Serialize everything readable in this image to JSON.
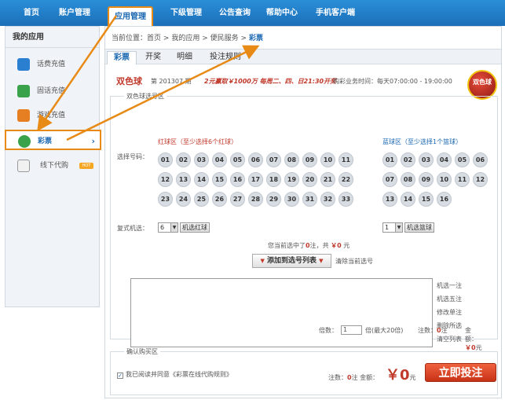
{
  "topnav": {
    "items": [
      "首页",
      "账户管理",
      "应用管理",
      "下级管理",
      "公告查询",
      "帮助中心",
      "手机客户端"
    ],
    "active_index": 2
  },
  "sidebar": {
    "title": "我的应用",
    "items": [
      {
        "label": "话费充值",
        "icon": "phone-icon"
      },
      {
        "label": "固话充值",
        "icon": "landline-icon"
      },
      {
        "label": "游戏充值",
        "icon": "game-icon"
      },
      {
        "label": "彩票",
        "icon": "lottery-icon"
      },
      {
        "label": "线下代购",
        "icon": "cart-icon"
      }
    ],
    "active_index": 3,
    "chevron": "›",
    "hot_badge": "HOT"
  },
  "breadcrumb": {
    "prefix": "当前位置：",
    "items": [
      "首页",
      "我的应用",
      "便民服务"
    ],
    "separator": ">",
    "current": "彩票"
  },
  "tabs": [
    "彩票",
    "开奖",
    "明细",
    "投注规则"
  ],
  "active_tab": 0,
  "issue": {
    "name": "双色球",
    "issue_text": "第 201307 期",
    "promo": "2元赢取￥1000万 每周二、四、日21:30开奖",
    "hours": "购彩业务时间：每天07:00:00 - 19:00:00",
    "logo_text": "双色球"
  },
  "selector": {
    "legend": "双色球选号区",
    "red_zone_title": "红球区（至少选择6个红球）",
    "blue_zone_title": "蓝球区（至少选择1个篮球）",
    "select_label": "选择号码：",
    "red_balls": [
      "01",
      "02",
      "03",
      "04",
      "05",
      "06",
      "07",
      "08",
      "09",
      "10",
      "11",
      "12",
      "13",
      "14",
      "15",
      "16",
      "17",
      "18",
      "19",
      "20",
      "21",
      "22",
      "23",
      "24",
      "25",
      "26",
      "27",
      "28",
      "29",
      "30",
      "31",
      "32",
      "33"
    ],
    "blue_balls": [
      "01",
      "02",
      "03",
      "04",
      "05",
      "06",
      "07",
      "08",
      "09",
      "10",
      "11",
      "12",
      "13",
      "14",
      "15",
      "16"
    ],
    "multi_label": "复式机选：",
    "red_count": "6",
    "red_random_btn": "机选红球",
    "blue_count": "1",
    "blue_random_btn": "机选篮球",
    "dropdown_arrow": "▼"
  },
  "status": {
    "text1": "您当前选中了",
    "count": "0",
    "text2": "注，共",
    "amount": "￥0",
    "text3": "元"
  },
  "add_btn": {
    "arrow": "▼",
    "label": "添加到选号列表"
  },
  "clear_current": "清除当前选号",
  "side_links": [
    "机选一注",
    "机选五注",
    "修改单注",
    "删除所选",
    "清空列表"
  ],
  "footer": {
    "mult_label": "倍数：",
    "mult_value": "1",
    "mult_hint": "倍(最大20倍)",
    "bets_label": "注数：",
    "bets_value": "0",
    "bets_unit": "注",
    "amount_label": "金额：",
    "amount_value": "￥0",
    "amount_unit": "元"
  },
  "confirm": {
    "legend": "确认购买区",
    "agree_check": "✓",
    "agree_text": "我已阅读并同意《彩票在线代购规则》",
    "sum_bets_label": "注数：",
    "sum_bets": "0",
    "sum_bets_unit": "注",
    "sum_amount_label": "金额：",
    "big_amount": "￥0",
    "big_unit": "元",
    "bet_button": "立即投注"
  },
  "colors": {
    "accent": "#1a67b1",
    "annotation": "#e88a16",
    "danger": "#c0392b"
  }
}
